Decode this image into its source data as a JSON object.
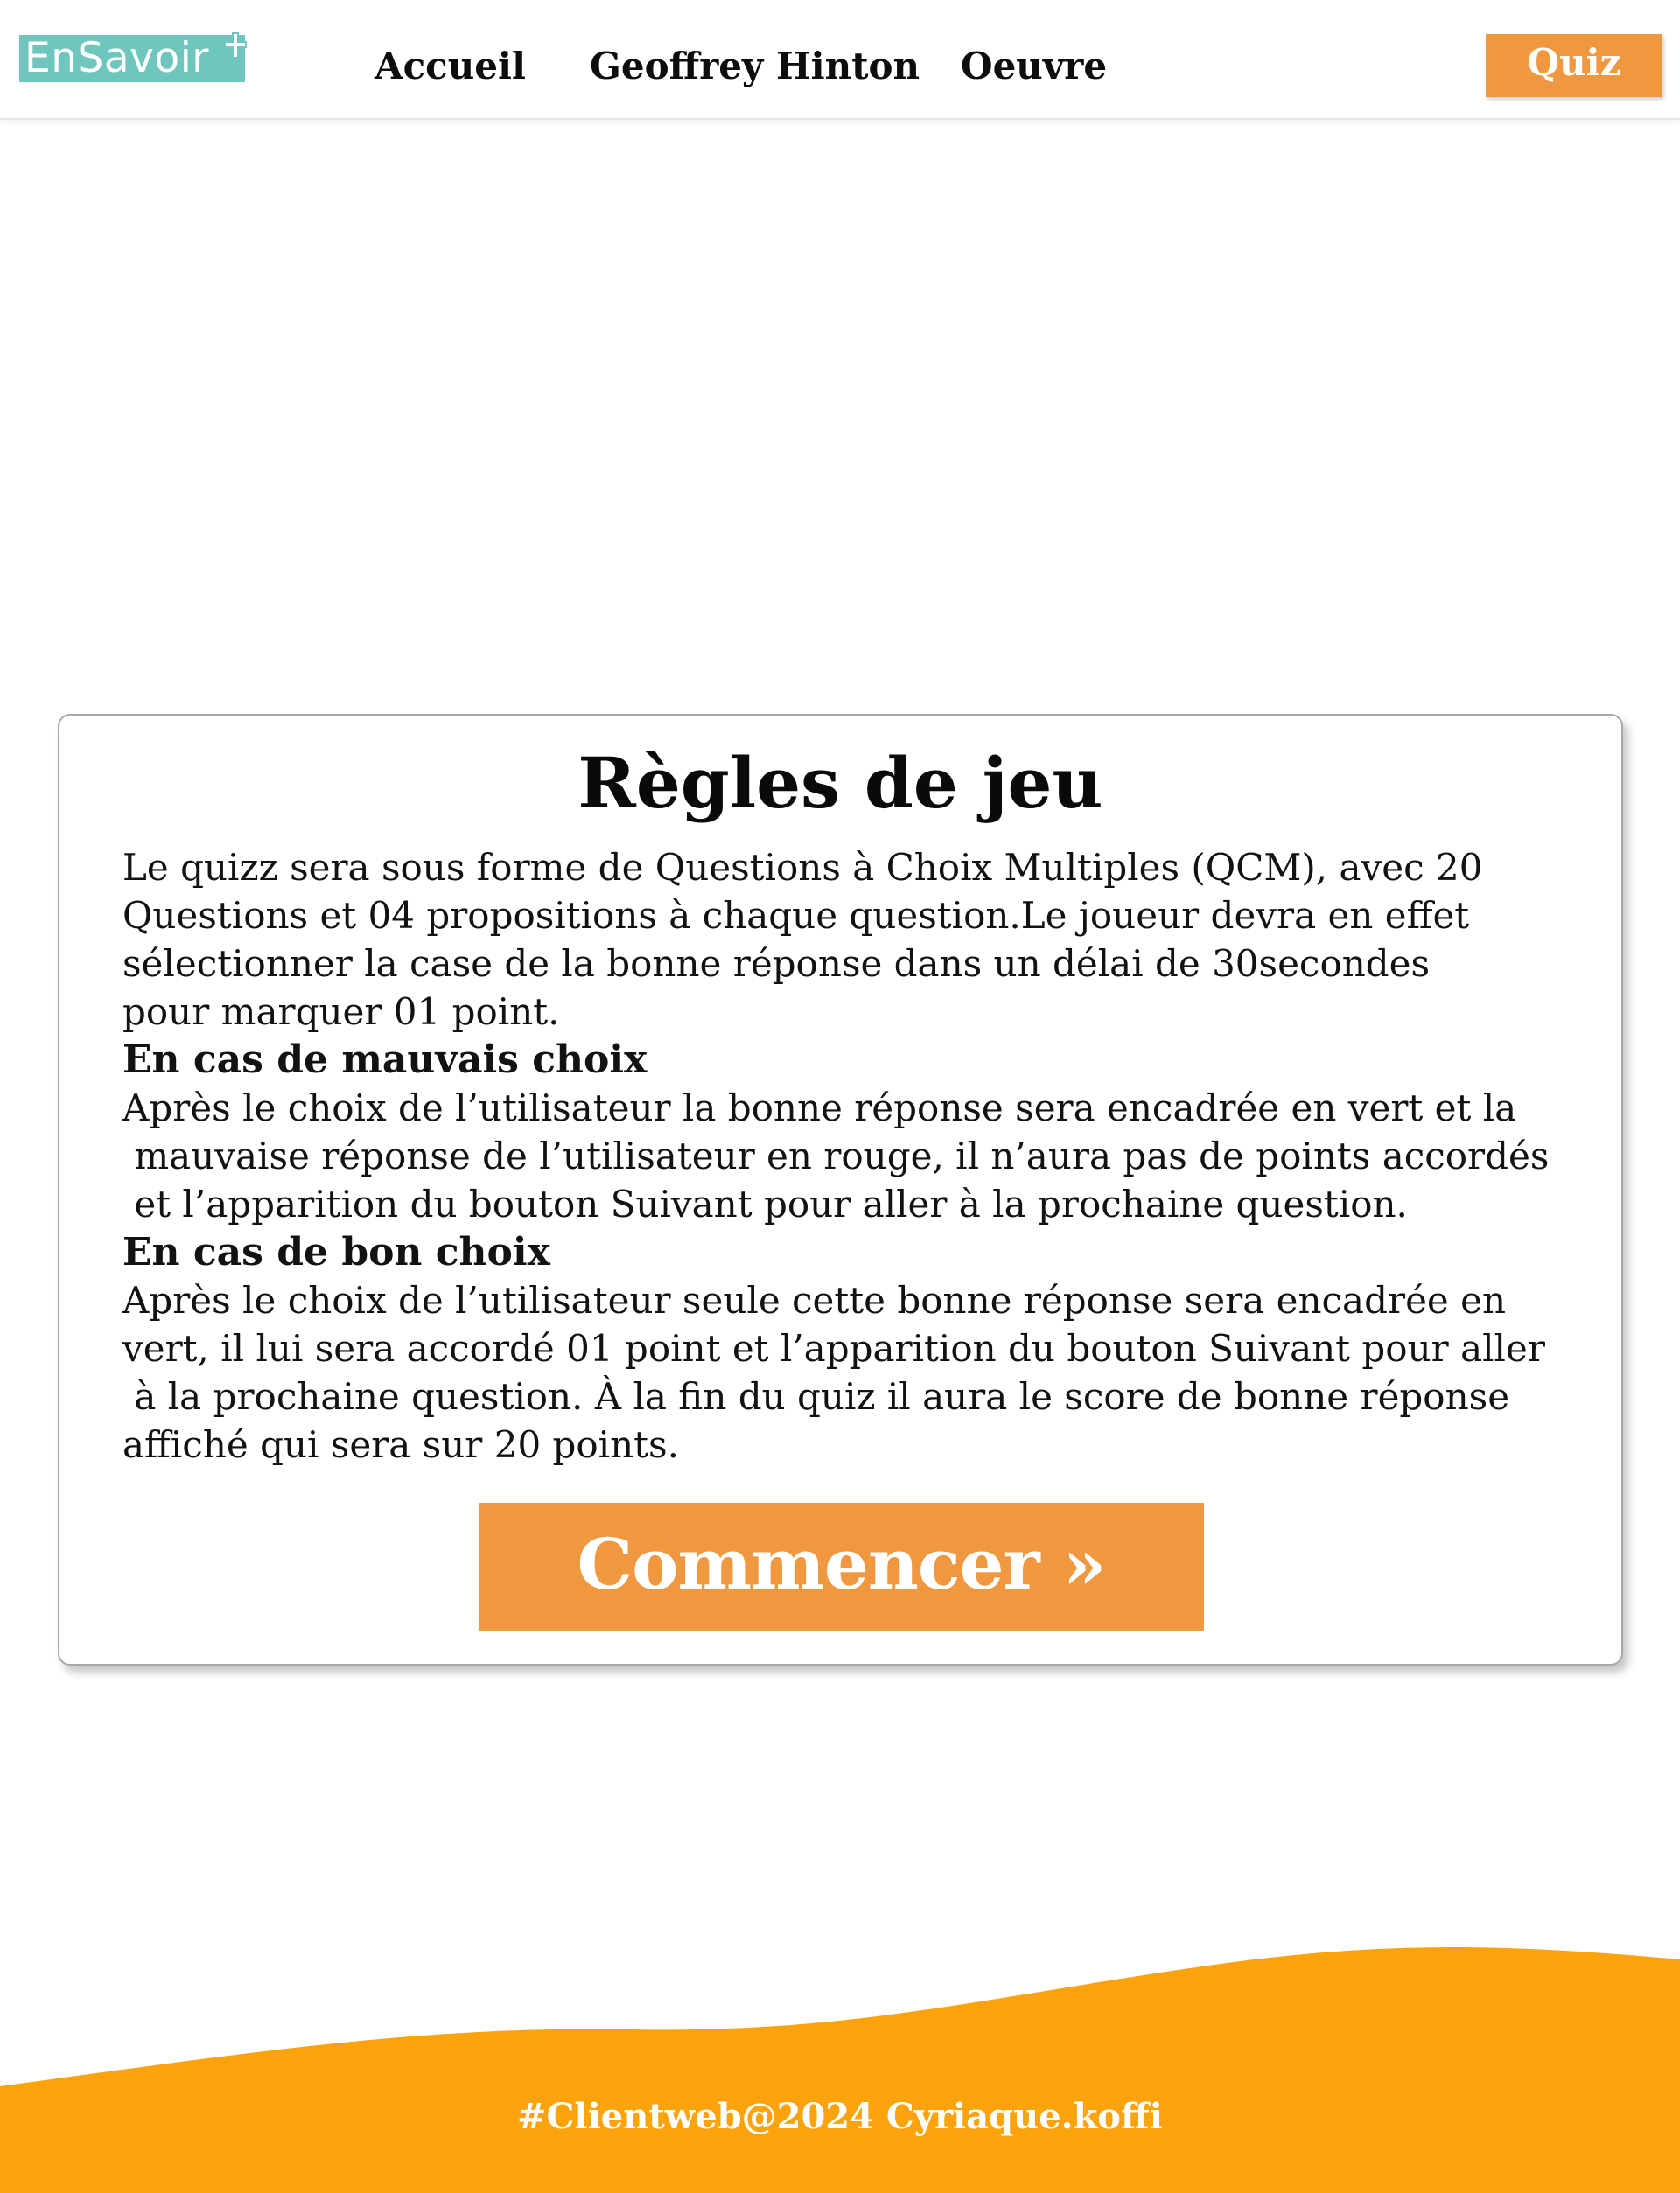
{
  "header": {
    "logo": {
      "text": "EnSavoir",
      "plus": "+"
    },
    "nav": {
      "accueil": "Accueil",
      "hinton": "Geoffrey Hinton",
      "oeuvre": "Oeuvre"
    },
    "quiz_button": "Quiz"
  },
  "rules": {
    "title": "Règles de jeu",
    "intro_lines": [
      "Le quizz sera sous forme de Questions à Choix Multiples (QCM), avec 20",
      "Questions et 04 propositions à chaque question.Le joueur devra en effet",
      "sélectionner la case de la bonne réponse dans un délai de 30secondes",
      "pour marquer 01 point."
    ],
    "bad_choice": {
      "heading": "En cas de mauvais choix",
      "lines": [
        "Après le choix de l’utilisateur la bonne réponse sera encadrée en vert et la",
        " mauvaise réponse de l’utilisateur en rouge, il n’aura pas de points accordés",
        " et l’apparition du bouton Suivant pour aller à la prochaine question."
      ]
    },
    "good_choice": {
      "heading": "En cas de bon choix",
      "lines": [
        "Après le choix de l’utilisateur seule cette bonne réponse sera encadrée en",
        "vert, il lui sera accordé 01 point et l’apparition du bouton Suivant pour aller",
        " à la prochaine question. À la fin du quiz il aura le score de bonne réponse",
        "affiché qui sera sur 20 points."
      ]
    },
    "start_button": "Commencer »"
  },
  "footer": {
    "text": "#Clientweb@2024 Cyriaque.koffi"
  },
  "colors": {
    "logo_teal": "#6fc6bc",
    "accent_orange": "#f09840",
    "footer_orange": "#fba30d"
  }
}
